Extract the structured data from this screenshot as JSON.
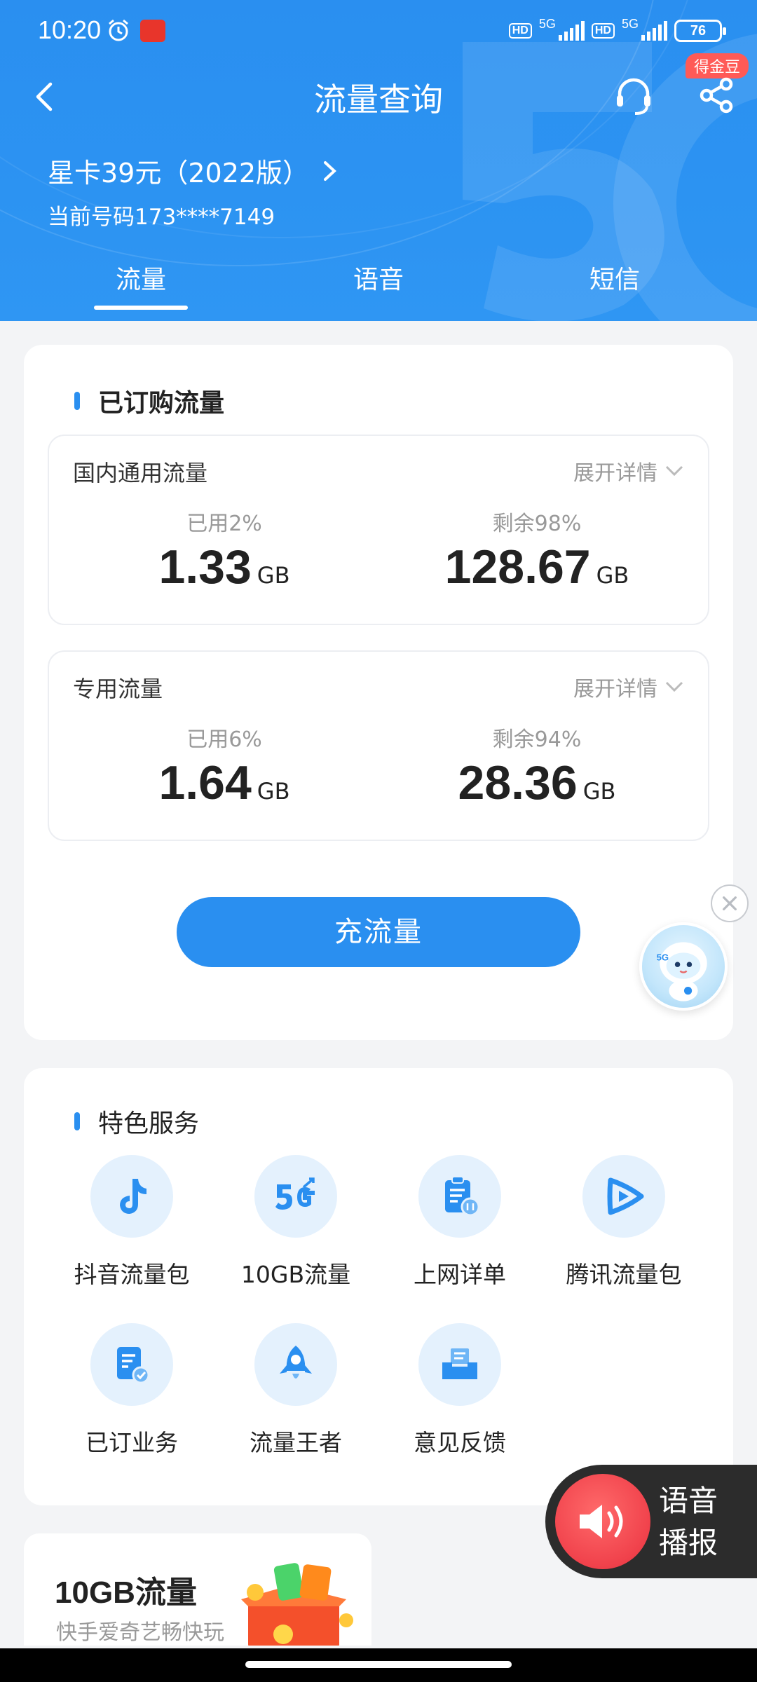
{
  "status_bar": {
    "time": "10:20",
    "hd1": "HD",
    "net1": "5G",
    "hd2": "HD",
    "net2": "5G",
    "battery": "76"
  },
  "nav": {
    "title": "流量查询",
    "badge": "得金豆",
    "back_icon": "chevron-left-icon",
    "service_icon": "headset-icon",
    "share_icon": "share-icon"
  },
  "plan": {
    "name": "星卡39元（2022版）",
    "phone": "当前号码173****7149"
  },
  "tabs": [
    {
      "label": "流量",
      "active": true
    },
    {
      "label": "语音",
      "active": false
    },
    {
      "label": "短信",
      "active": false
    }
  ],
  "subscribed": {
    "title": "已订购流量",
    "items": [
      {
        "name": "国内通用流量",
        "detail": "展开详情",
        "used_pct": "已用2%",
        "used": "1.33",
        "remain_pct": "剩余98%",
        "remain": "128.67",
        "unit": "GB"
      },
      {
        "name": "专用流量",
        "detail": "展开详情",
        "used_pct": "已用6%",
        "used": "1.64",
        "remain_pct": "剩余94%",
        "remain": "28.36",
        "unit": "GB"
      }
    ],
    "recharge_label": "充流量"
  },
  "services": {
    "title": "特色服务",
    "items": [
      {
        "label": "抖音流量包",
        "icon": "douyin-icon"
      },
      {
        "label": "10GB流量",
        "icon": "5g-icon"
      },
      {
        "label": "上网详单",
        "icon": "clipboard-icon"
      },
      {
        "label": "腾讯流量包",
        "icon": "play-icon"
      },
      {
        "label": "已订业务",
        "icon": "document-check-icon"
      },
      {
        "label": "流量王者",
        "icon": "rocket-icon"
      },
      {
        "label": "意见反馈",
        "icon": "feedback-box-icon"
      }
    ]
  },
  "voice": {
    "line1": "语音",
    "line2": "播报"
  },
  "promo": {
    "title": "10GB流量",
    "subtitle": "快手爱奇艺畅快玩"
  },
  "colors": {
    "brand": "#2a8ff0",
    "badge": "#ff5a57",
    "voice_red": "#f0414b"
  }
}
